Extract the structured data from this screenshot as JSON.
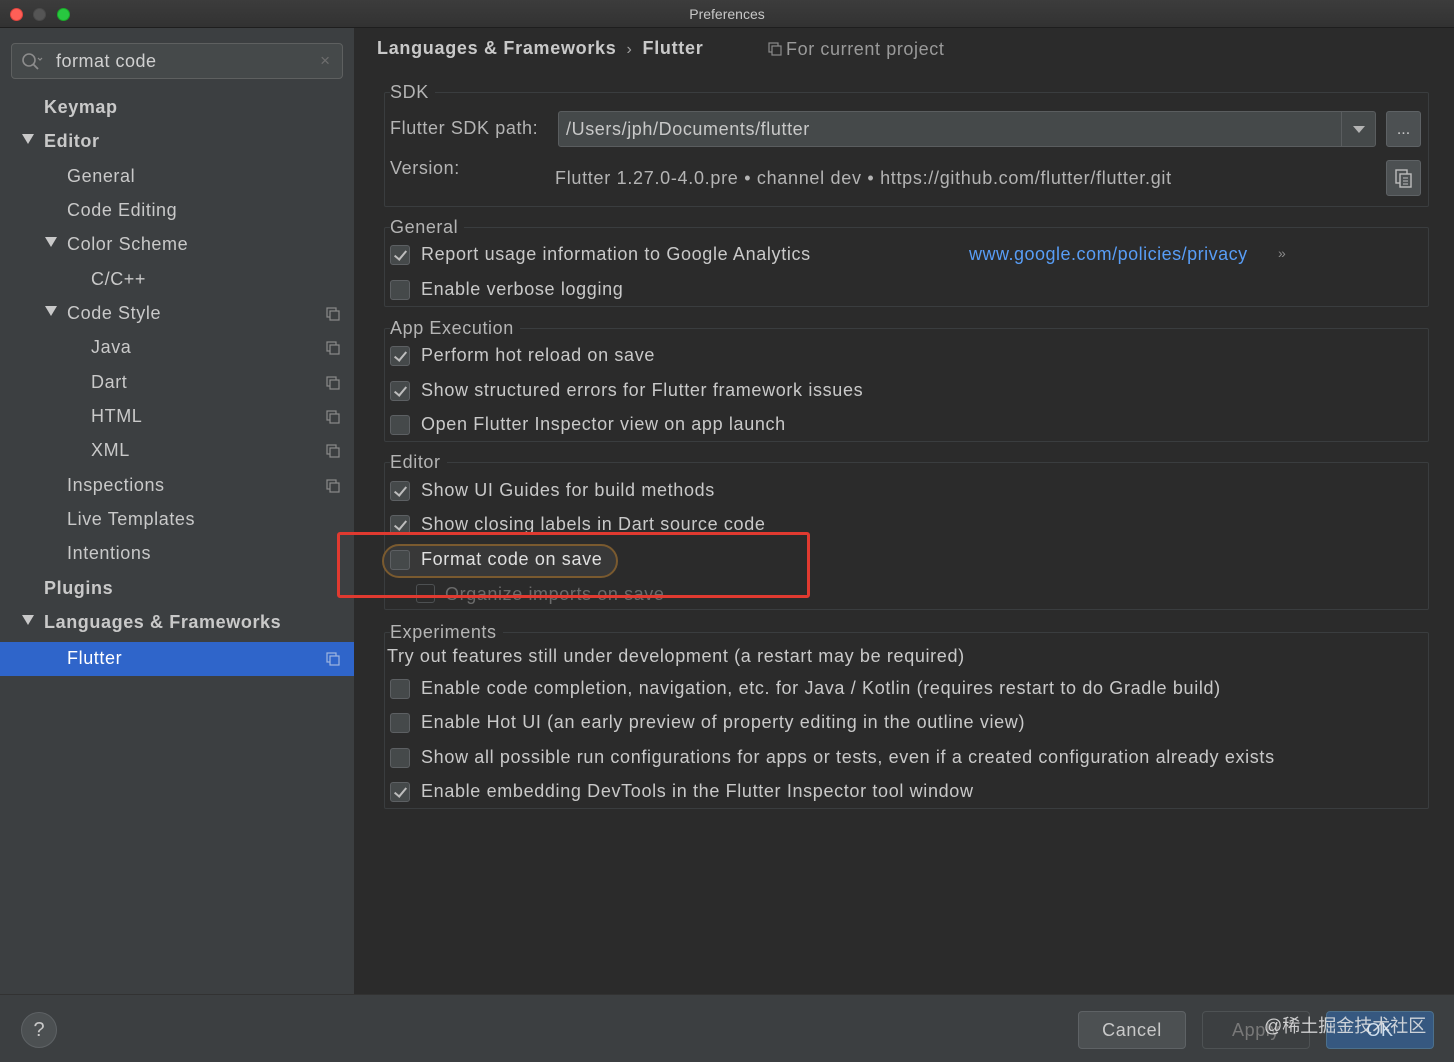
{
  "window": {
    "title": "Preferences"
  },
  "search": {
    "value": "format code",
    "clear_glyph": "×"
  },
  "sidebar": {
    "items": [
      {
        "label": "Keymap"
      },
      {
        "label": "Editor"
      },
      {
        "label": "General"
      },
      {
        "label": "Code Editing"
      },
      {
        "label": "Color Scheme"
      },
      {
        "label": "C/C++"
      },
      {
        "label": "Code Style"
      },
      {
        "label": "Java"
      },
      {
        "label": "Dart"
      },
      {
        "label": "HTML"
      },
      {
        "label": "XML"
      },
      {
        "label": "Inspections"
      },
      {
        "label": "Live Templates"
      },
      {
        "label": "Intentions"
      },
      {
        "label": "Plugins"
      },
      {
        "label": "Languages & Frameworks"
      },
      {
        "label": "Flutter",
        "selected": true
      }
    ]
  },
  "breadcrumb": {
    "parent": "Languages & Frameworks",
    "separator": "›",
    "current": "Flutter",
    "scope": "For current project"
  },
  "sdk": {
    "group_title": "SDK",
    "path_label": "Flutter SDK path:",
    "path_value": "/Users/jph/Documents/flutter",
    "browse_label": "...",
    "version_label": "Version:",
    "version_value": "Flutter 1.27.0-4.0.pre • channel dev • https://github.com/flutter/flutter.git"
  },
  "general": {
    "group_title": "General",
    "options": [
      {
        "label": "Report usage information to Google Analytics",
        "checked": true
      },
      {
        "label": "Enable verbose logging",
        "checked": false
      }
    ],
    "privacy_link": "www.google.com/policies/privacy",
    "link_arrow": "»"
  },
  "app_execution": {
    "group_title": "App Execution",
    "options": [
      {
        "label": "Perform hot reload on save",
        "checked": true
      },
      {
        "label": "Show structured errors for Flutter framework issues",
        "checked": true
      },
      {
        "label": "Open Flutter Inspector view on app launch",
        "checked": false
      }
    ]
  },
  "editor": {
    "group_title": "Editor",
    "options": [
      {
        "label": "Show UI Guides for build methods",
        "checked": true
      },
      {
        "label": "Show closing labels in Dart source code",
        "checked": true
      },
      {
        "label": "Format code on save",
        "checked": false
      }
    ],
    "disabled_option": "Organize imports on save"
  },
  "experiments": {
    "group_title": "Experiments",
    "description": "Try out features still under development (a restart may be required)",
    "options": [
      {
        "label": "Enable code completion, navigation, etc. for Java / Kotlin (requires restart to do Gradle build)",
        "checked": false
      },
      {
        "label": "Enable Hot UI (an early preview of property editing in the outline view)",
        "checked": false
      },
      {
        "label": "Show all possible run configurations for apps or tests, even if a created configuration already exists",
        "checked": false
      },
      {
        "label": "Enable embedding DevTools in the Flutter Inspector tool window",
        "checked": true
      }
    ]
  },
  "footer": {
    "help_label": "?",
    "cancel_label": "Cancel",
    "apply_label": "Apply",
    "ok_label": "OK",
    "watermark": "@稀土掘金技术社区"
  },
  "colors": {
    "accent_selection": "#2f65ca",
    "link": "#589df6",
    "annotation_box": "#e03a30",
    "ok_button": "#365880"
  }
}
